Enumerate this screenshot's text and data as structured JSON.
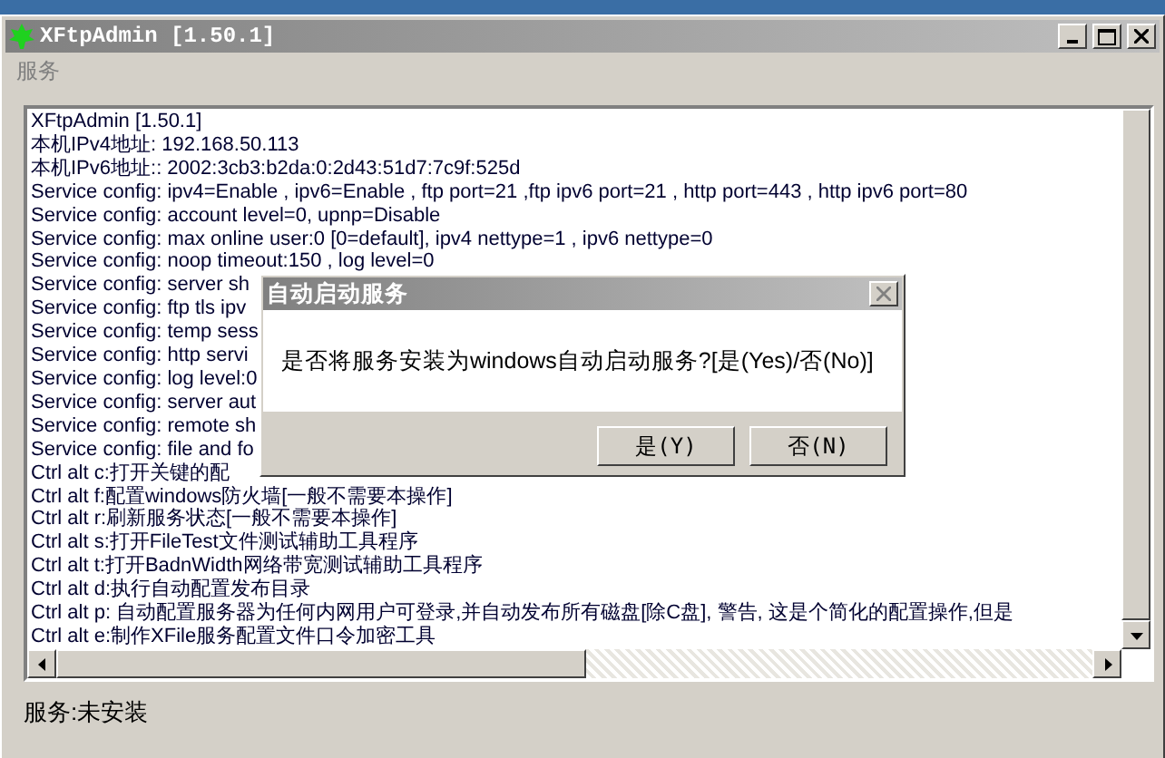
{
  "window": {
    "title": "XFtpAdmin [1.50.1]"
  },
  "menu": [
    {
      "label": "服务"
    }
  ],
  "log": {
    "lines": [
      "XFtpAdmin [1.50.1]",
      "本机IPv4地址: 192.168.50.113",
      "本机IPv6地址:: 2002:3cb3:b2da:0:2d43:51d7:7c9f:525d",
      "Service config: ipv4=Enable , ipv6=Enable , ftp port=21 ,ftp ipv6 port=21 , http port=443 , http ipv6 port=80",
      "Service config: account level=0, upnp=Disable",
      "Service config: max online user:0 [0=default], ipv4 nettype=1 , ipv6 nettype=0",
      "Service config: noop timeout:150 , log level=0",
      "Service config: server sh",
      "Service config: ftp tls ipv",
      "Service config: temp sess",
      "Service config: http servi",
      "Service config: log level:0",
      "Service config: server aut",
      "Service config: remote sh",
      "Service config: file and fo",
      "Ctrl alt c:打开关键的配",
      "Ctrl alt f:配置windows防火墙[一般不需要本操作]",
      "Ctrl alt r:刷新服务状态[一般不需要本操作]",
      "Ctrl alt s:打开FileTest文件测试辅助工具程序",
      "Ctrl alt t:打开BadnWidth网络带宽测试辅助工具程序",
      "Ctrl alt d:执行自动配置发布目录",
      "Ctrl alt p: 自动配置服务器为任何内网用户可登录,并自动发布所有磁盘[除C盘], 警告, 这是个简化的配置操作,但是",
      "Ctrl alt e:制作XFile服务配置文件口令加密工具"
    ]
  },
  "status": "服务:未安装",
  "dialog": {
    "title": "自动启动服务",
    "message": "是否将服务安装为windows自动启动服务?[是(Yes)/否(No)]",
    "buttons": [
      {
        "label": "是(Y)"
      },
      {
        "label": "否(N)"
      }
    ]
  }
}
